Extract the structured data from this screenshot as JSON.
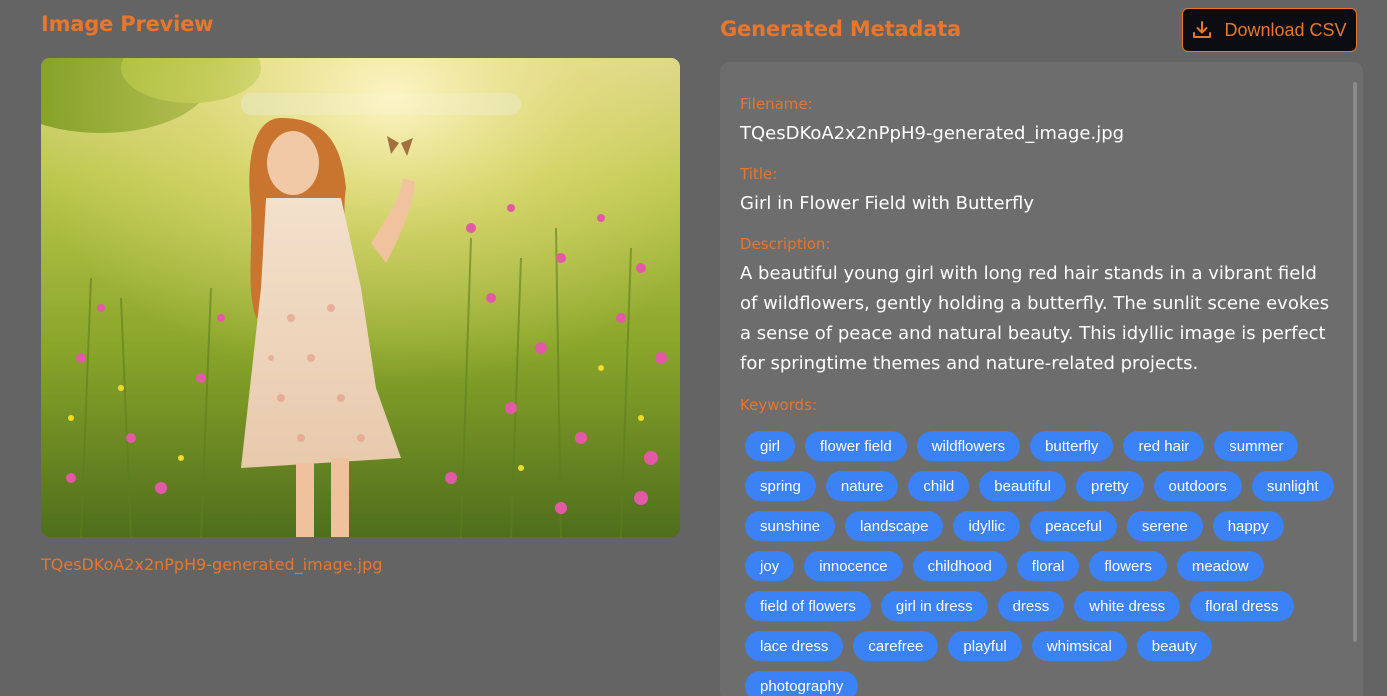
{
  "preview": {
    "heading": "Image Preview",
    "filename_caption": "TQesDKoA2x2nPpH9-generated_image.jpg"
  },
  "metadata": {
    "heading": "Generated Metadata",
    "download_label": "Download CSV",
    "filename_label": "Filename:",
    "filename_value": "TQesDKoA2x2nPpH9-generated_image.jpg",
    "title_label": "Title:",
    "title_value": "Girl in Flower Field with Butterfly",
    "description_label": "Description:",
    "description_value": "A beautiful young girl with long red hair stands in a vibrant field of wildflowers, gently holding a butterfly. The sunlit scene evokes a sense of peace and natural beauty. This idyllic image is perfect for springtime themes and nature-related projects.",
    "keywords_label": "Keywords:",
    "keywords": [
      "girl",
      "flower field",
      "wildflowers",
      "butterfly",
      "red hair",
      "summer",
      "spring",
      "nature",
      "child",
      "beautiful",
      "pretty",
      "outdoors",
      "sunlight",
      "sunshine",
      "landscape",
      "idyllic",
      "peaceful",
      "serene",
      "happy",
      "joy",
      "innocence",
      "childhood",
      "floral",
      "flowers",
      "meadow",
      "field of flowers",
      "girl in dress",
      "dress",
      "white dress",
      "floral dress",
      "lace dress",
      "carefree",
      "playful",
      "whimsical",
      "beauty",
      "photography"
    ]
  },
  "colors": {
    "accent": "#e7772e",
    "background": "#646464",
    "panel": "#6d6d6d",
    "chip": "#3b82f6",
    "button_bg": "#0b0d13"
  },
  "icons": {
    "download": "download-icon"
  }
}
